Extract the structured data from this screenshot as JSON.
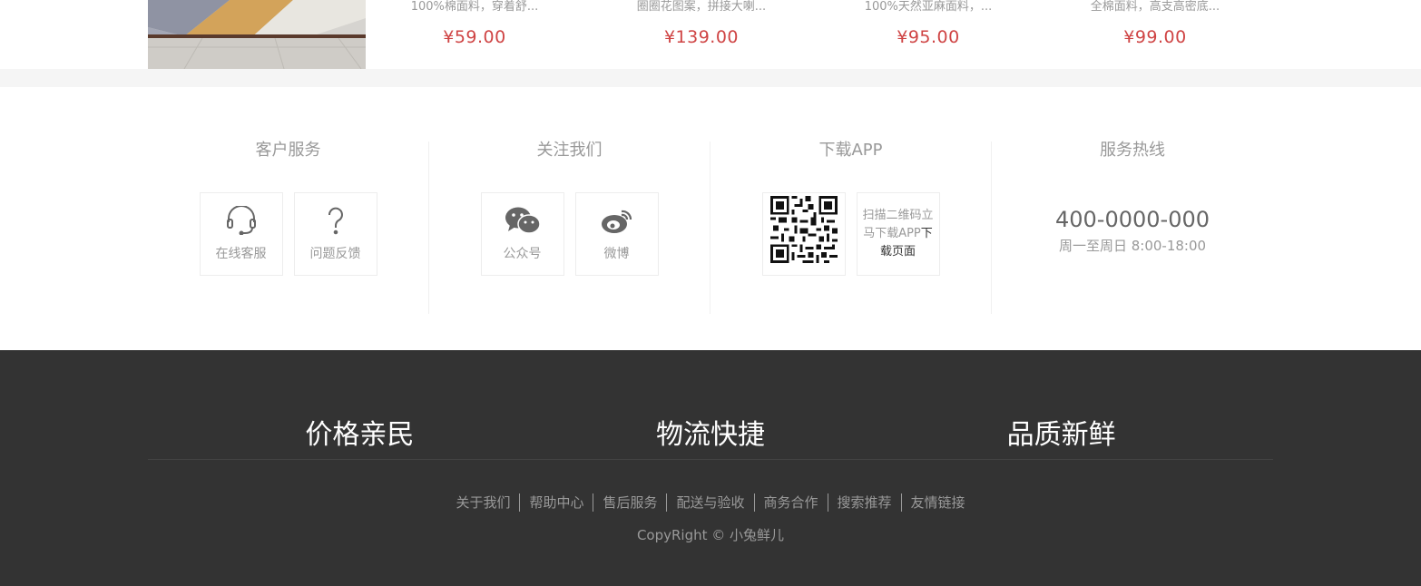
{
  "products": [
    {
      "desc": "100%棉面料，穿着舒...",
      "price": "¥59.00"
    },
    {
      "desc": "圈圈花图案，拼接大喇...",
      "price": "¥139.00"
    },
    {
      "desc": "100%天然亚麻面料，...",
      "price": "¥95.00"
    },
    {
      "desc": "全棉面料，高支高密底...",
      "price": "¥99.00"
    }
  ],
  "contact": {
    "service": {
      "title": "客户服务",
      "online": "在线客服",
      "feedback": "问题反馈"
    },
    "follow": {
      "title": "关注我们",
      "wechat": "公众号",
      "weibo": "微博"
    },
    "app": {
      "title": "下载APP",
      "tip_part1": "扫描二维码立马下载APP",
      "tip_part2": "下载页面"
    },
    "hotline": {
      "title": "服务热线",
      "phone": "400-0000-000",
      "hours": "周一至周日 8:00-18:00"
    }
  },
  "footer": {
    "slogans": [
      "价格亲民",
      "物流快捷",
      "品质新鲜"
    ],
    "links": [
      "关于我们",
      "帮助中心",
      "售后服务",
      "配送与验收",
      "商务合作",
      "搜索推荐",
      "友情链接"
    ],
    "copyright": "CopyRight © 小兔鲜儿"
  },
  "colors": {
    "price": "#cf4444",
    "footer_bg": "#333333",
    "muted": "#999999"
  }
}
